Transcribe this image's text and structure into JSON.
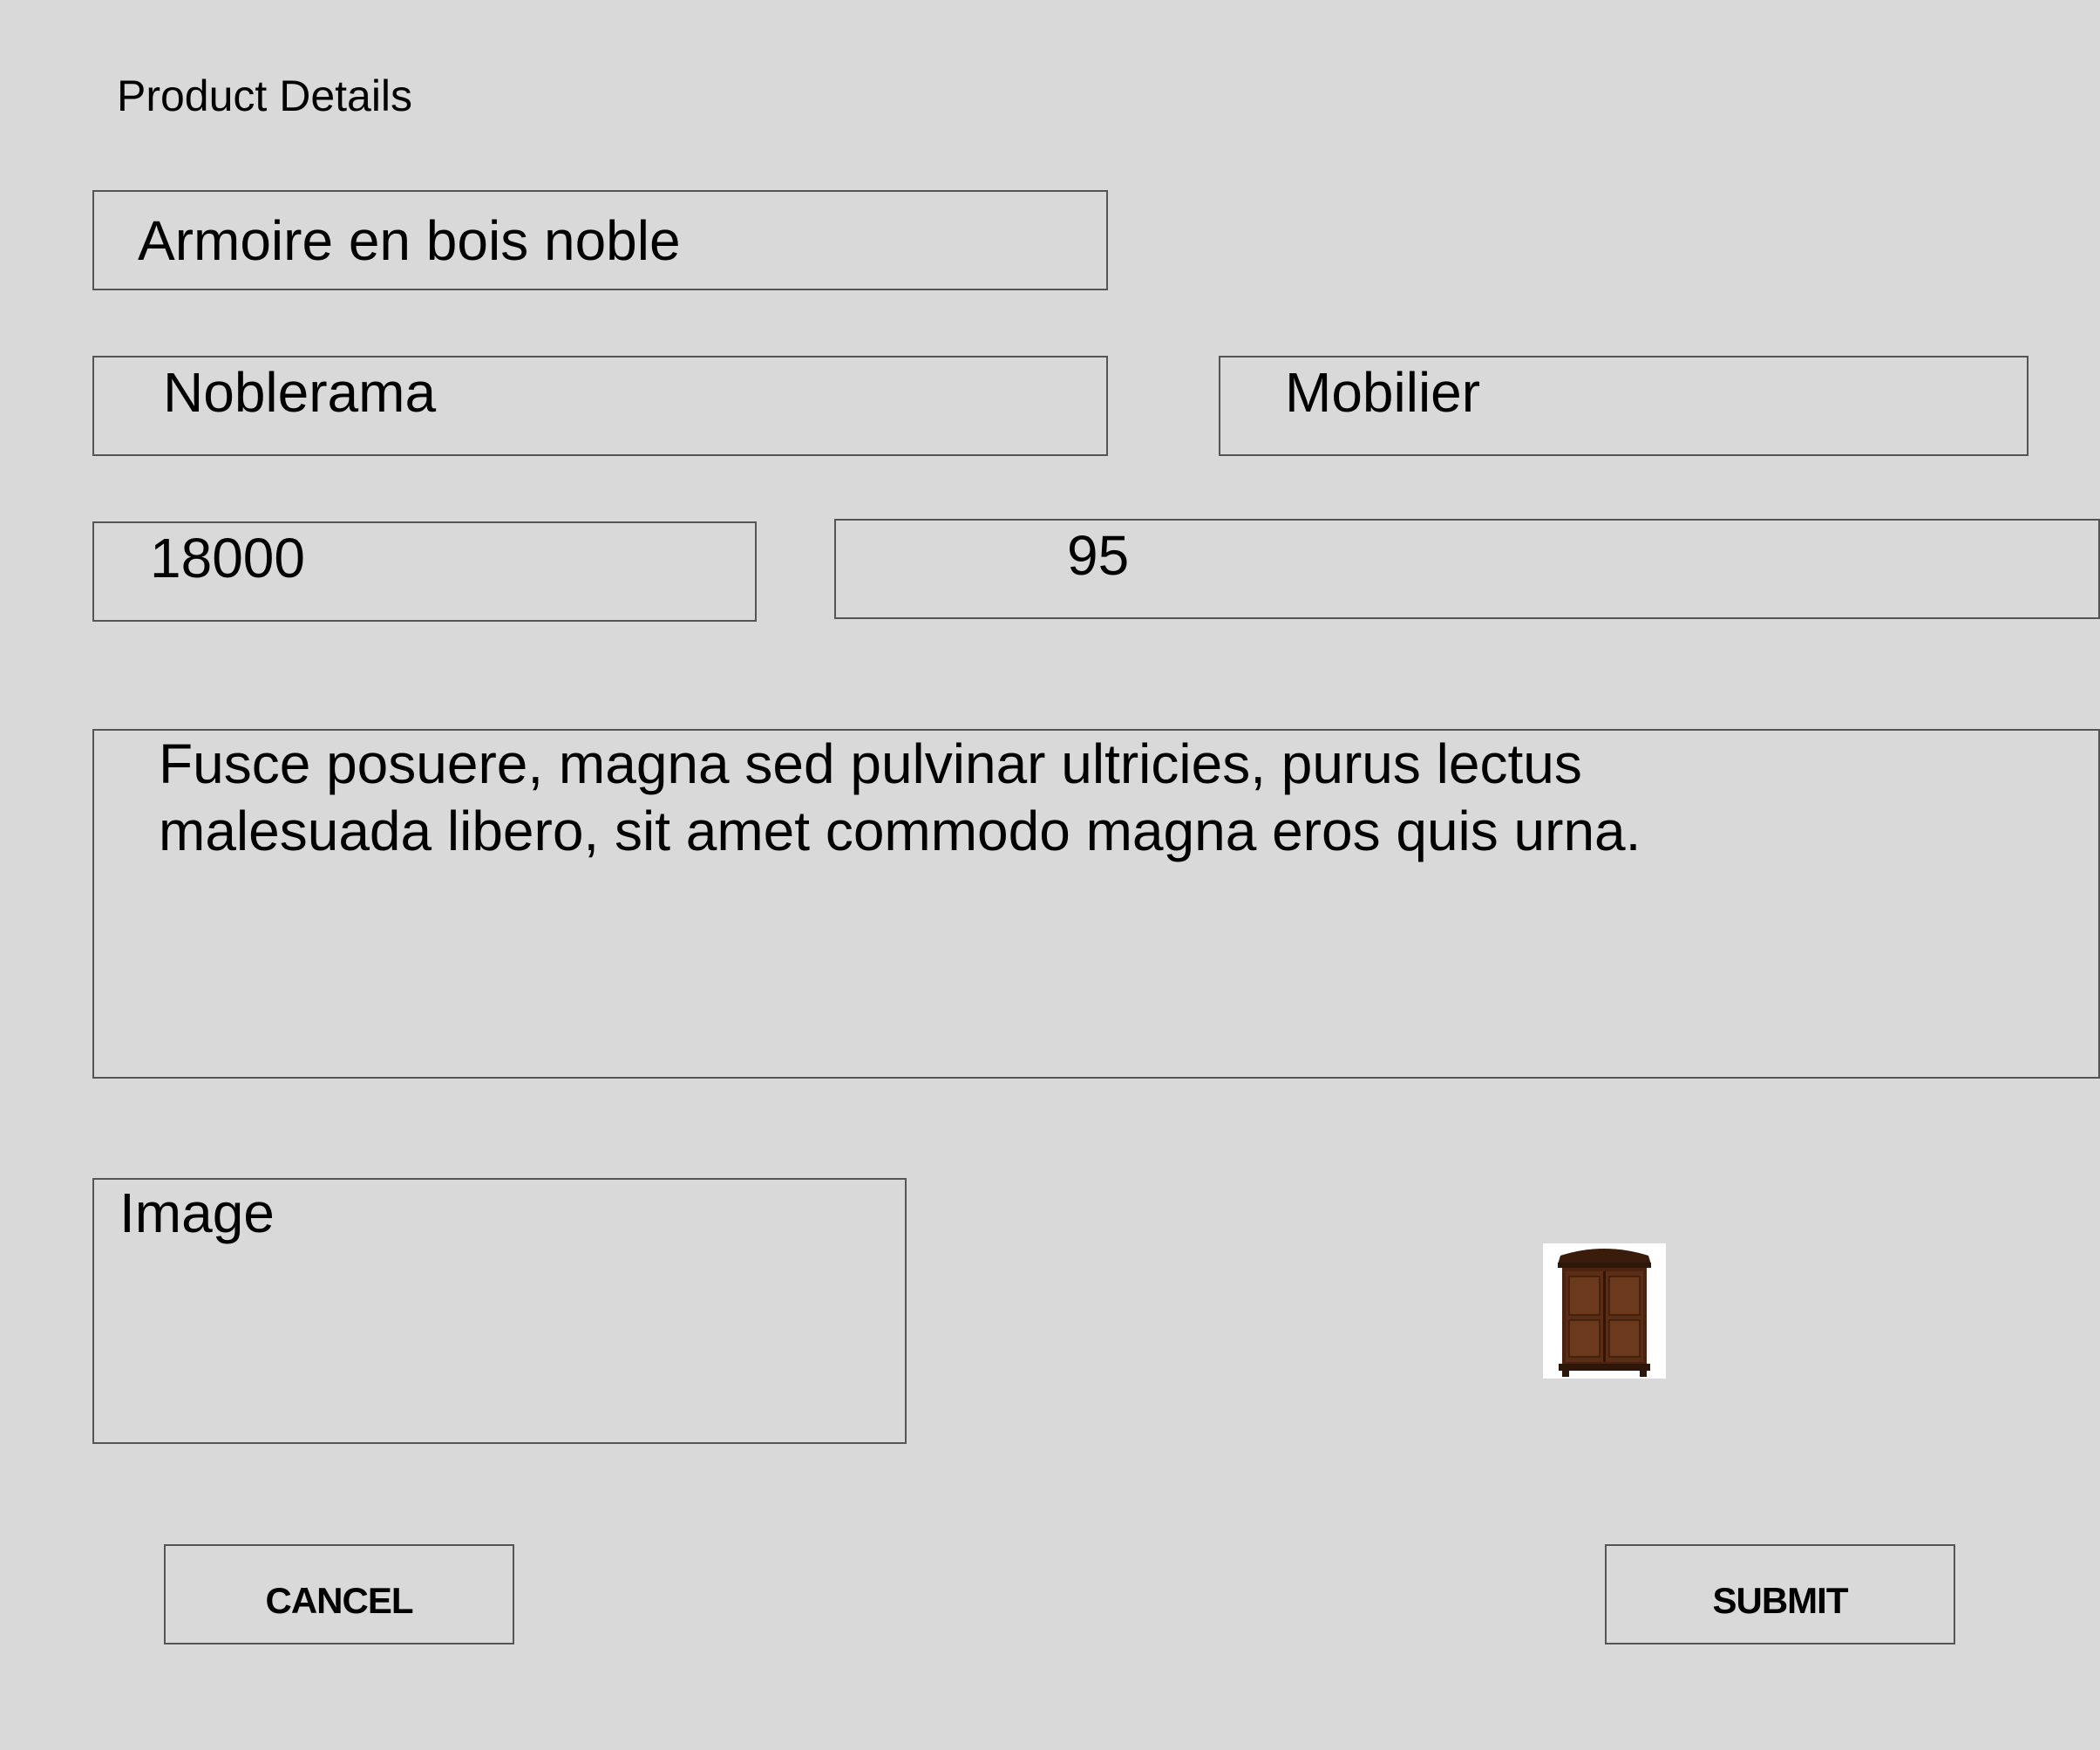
{
  "header": {
    "title": "Product Details"
  },
  "form": {
    "product_name": "Armoire en bois noble",
    "brand": "Noblerama",
    "category": "Mobilier",
    "price": "18000",
    "stock": "95",
    "description_line1": "Fusce posuere, magna sed pulvinar ultricies, purus lectus",
    "description_line2": "malesuada libero, sit amet commodo magna eros quis urna.",
    "image_label": "Image"
  },
  "image_preview": {
    "icon": "armoire-wardrobe-image"
  },
  "buttons": {
    "cancel_label": "CANCEL",
    "submit_label": "SUBMIT"
  },
  "colors": {
    "background": "#d9d9d9",
    "border": "#555555",
    "wood": "#4a2410"
  }
}
